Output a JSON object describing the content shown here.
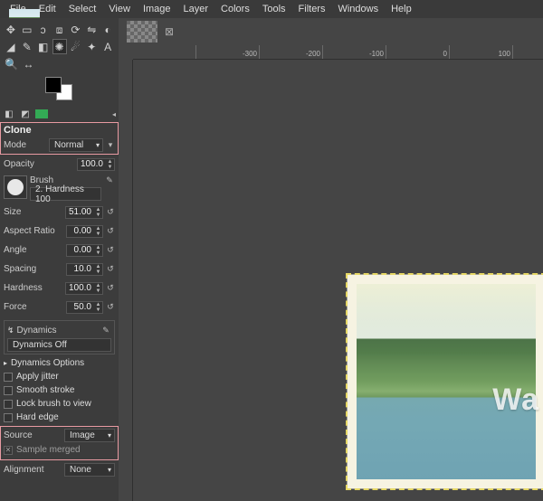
{
  "menu": [
    "File",
    "Edit",
    "Select",
    "View",
    "Image",
    "Layer",
    "Colors",
    "Tools",
    "Filters",
    "Windows",
    "Help"
  ],
  "ruler_marks": [
    "",
    "-300",
    "-200",
    "-100",
    "0",
    "100"
  ],
  "toolbox": {
    "active": "clone"
  },
  "tool_title": "Clone",
  "mode": {
    "label": "Mode",
    "value": "Normal"
  },
  "sliders": {
    "opacity": {
      "label": "Opacity",
      "value": "100.0"
    },
    "size": {
      "label": "Size",
      "value": "51.00"
    },
    "aspect": {
      "label": "Aspect Ratio",
      "value": "0.00"
    },
    "angle": {
      "label": "Angle",
      "value": "0.00"
    },
    "spacing": {
      "label": "Spacing",
      "value": "10.0"
    },
    "hardness": {
      "label": "Hardness",
      "value": "100.0"
    },
    "force": {
      "label": "Force",
      "value": "50.0"
    }
  },
  "brush": {
    "label": "Brush",
    "name": "2. Hardness 100"
  },
  "dynamics": {
    "label": "Dynamics",
    "value": "Dynamics Off",
    "options_label": "Dynamics Options"
  },
  "checks": {
    "jitter": "Apply jitter",
    "smooth": "Smooth stroke",
    "lock": "Lock brush to view",
    "hard": "Hard edge"
  },
  "source": {
    "label": "Source",
    "value": "Image",
    "sample_merged": "Sample merged",
    "sample_checked": true
  },
  "alignment": {
    "label": "Alignment",
    "value": "None"
  },
  "watermark": "Wa"
}
